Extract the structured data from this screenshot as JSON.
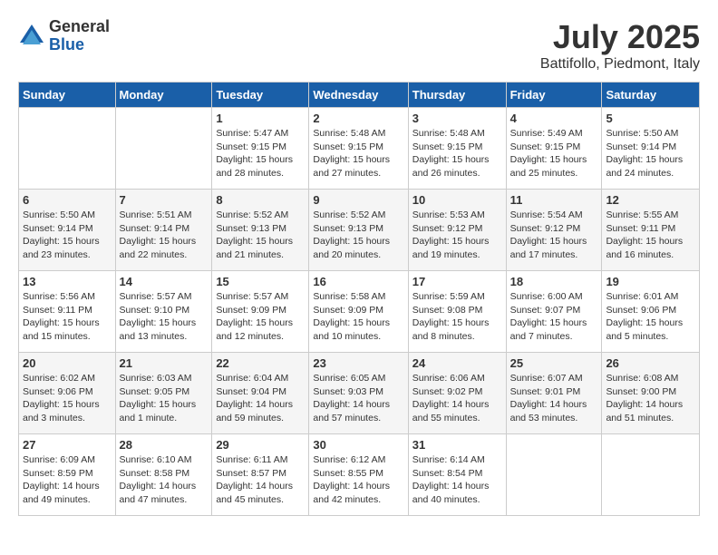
{
  "logo": {
    "general": "General",
    "blue": "Blue"
  },
  "title": {
    "month": "July 2025",
    "location": "Battifollo, Piedmont, Italy"
  },
  "days_of_week": [
    "Sunday",
    "Monday",
    "Tuesday",
    "Wednesday",
    "Thursday",
    "Friday",
    "Saturday"
  ],
  "weeks": [
    [
      {
        "day": "",
        "info": ""
      },
      {
        "day": "",
        "info": ""
      },
      {
        "day": "1",
        "info": "Sunrise: 5:47 AM\nSunset: 9:15 PM\nDaylight: 15 hours\nand 28 minutes."
      },
      {
        "day": "2",
        "info": "Sunrise: 5:48 AM\nSunset: 9:15 PM\nDaylight: 15 hours\nand 27 minutes."
      },
      {
        "day": "3",
        "info": "Sunrise: 5:48 AM\nSunset: 9:15 PM\nDaylight: 15 hours\nand 26 minutes."
      },
      {
        "day": "4",
        "info": "Sunrise: 5:49 AM\nSunset: 9:15 PM\nDaylight: 15 hours\nand 25 minutes."
      },
      {
        "day": "5",
        "info": "Sunrise: 5:50 AM\nSunset: 9:14 PM\nDaylight: 15 hours\nand 24 minutes."
      }
    ],
    [
      {
        "day": "6",
        "info": "Sunrise: 5:50 AM\nSunset: 9:14 PM\nDaylight: 15 hours\nand 23 minutes."
      },
      {
        "day": "7",
        "info": "Sunrise: 5:51 AM\nSunset: 9:14 PM\nDaylight: 15 hours\nand 22 minutes."
      },
      {
        "day": "8",
        "info": "Sunrise: 5:52 AM\nSunset: 9:13 PM\nDaylight: 15 hours\nand 21 minutes."
      },
      {
        "day": "9",
        "info": "Sunrise: 5:52 AM\nSunset: 9:13 PM\nDaylight: 15 hours\nand 20 minutes."
      },
      {
        "day": "10",
        "info": "Sunrise: 5:53 AM\nSunset: 9:12 PM\nDaylight: 15 hours\nand 19 minutes."
      },
      {
        "day": "11",
        "info": "Sunrise: 5:54 AM\nSunset: 9:12 PM\nDaylight: 15 hours\nand 17 minutes."
      },
      {
        "day": "12",
        "info": "Sunrise: 5:55 AM\nSunset: 9:11 PM\nDaylight: 15 hours\nand 16 minutes."
      }
    ],
    [
      {
        "day": "13",
        "info": "Sunrise: 5:56 AM\nSunset: 9:11 PM\nDaylight: 15 hours\nand 15 minutes."
      },
      {
        "day": "14",
        "info": "Sunrise: 5:57 AM\nSunset: 9:10 PM\nDaylight: 15 hours\nand 13 minutes."
      },
      {
        "day": "15",
        "info": "Sunrise: 5:57 AM\nSunset: 9:09 PM\nDaylight: 15 hours\nand 12 minutes."
      },
      {
        "day": "16",
        "info": "Sunrise: 5:58 AM\nSunset: 9:09 PM\nDaylight: 15 hours\nand 10 minutes."
      },
      {
        "day": "17",
        "info": "Sunrise: 5:59 AM\nSunset: 9:08 PM\nDaylight: 15 hours\nand 8 minutes."
      },
      {
        "day": "18",
        "info": "Sunrise: 6:00 AM\nSunset: 9:07 PM\nDaylight: 15 hours\nand 7 minutes."
      },
      {
        "day": "19",
        "info": "Sunrise: 6:01 AM\nSunset: 9:06 PM\nDaylight: 15 hours\nand 5 minutes."
      }
    ],
    [
      {
        "day": "20",
        "info": "Sunrise: 6:02 AM\nSunset: 9:06 PM\nDaylight: 15 hours\nand 3 minutes."
      },
      {
        "day": "21",
        "info": "Sunrise: 6:03 AM\nSunset: 9:05 PM\nDaylight: 15 hours\nand 1 minute."
      },
      {
        "day": "22",
        "info": "Sunrise: 6:04 AM\nSunset: 9:04 PM\nDaylight: 14 hours\nand 59 minutes."
      },
      {
        "day": "23",
        "info": "Sunrise: 6:05 AM\nSunset: 9:03 PM\nDaylight: 14 hours\nand 57 minutes."
      },
      {
        "day": "24",
        "info": "Sunrise: 6:06 AM\nSunset: 9:02 PM\nDaylight: 14 hours\nand 55 minutes."
      },
      {
        "day": "25",
        "info": "Sunrise: 6:07 AM\nSunset: 9:01 PM\nDaylight: 14 hours\nand 53 minutes."
      },
      {
        "day": "26",
        "info": "Sunrise: 6:08 AM\nSunset: 9:00 PM\nDaylight: 14 hours\nand 51 minutes."
      }
    ],
    [
      {
        "day": "27",
        "info": "Sunrise: 6:09 AM\nSunset: 8:59 PM\nDaylight: 14 hours\nand 49 minutes."
      },
      {
        "day": "28",
        "info": "Sunrise: 6:10 AM\nSunset: 8:58 PM\nDaylight: 14 hours\nand 47 minutes."
      },
      {
        "day": "29",
        "info": "Sunrise: 6:11 AM\nSunset: 8:57 PM\nDaylight: 14 hours\nand 45 minutes."
      },
      {
        "day": "30",
        "info": "Sunrise: 6:12 AM\nSunset: 8:55 PM\nDaylight: 14 hours\nand 42 minutes."
      },
      {
        "day": "31",
        "info": "Sunrise: 6:14 AM\nSunset: 8:54 PM\nDaylight: 14 hours\nand 40 minutes."
      },
      {
        "day": "",
        "info": ""
      },
      {
        "day": "",
        "info": ""
      }
    ]
  ]
}
